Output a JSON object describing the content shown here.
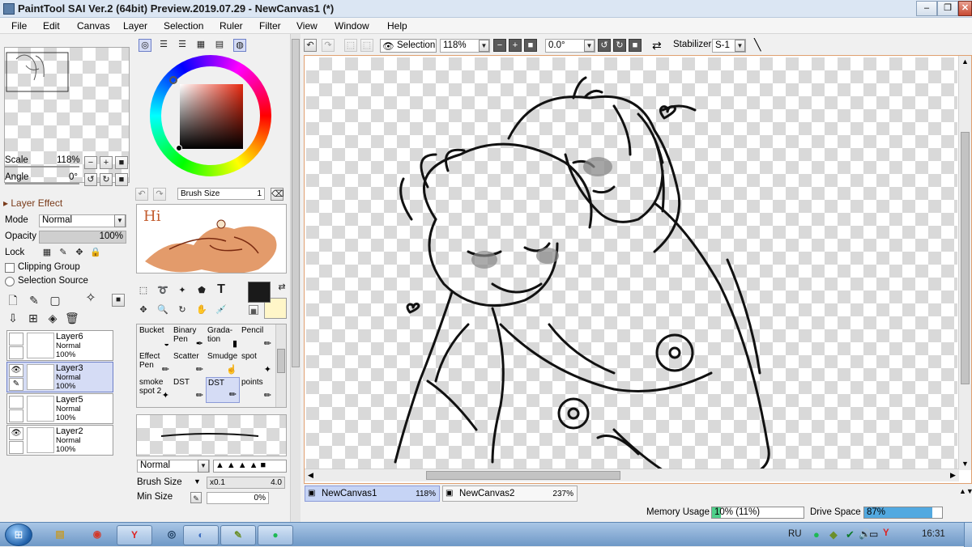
{
  "window": {
    "title": "PaintTool SAI Ver.2 (64bit) Preview.2019.07.29 - NewCanvas1 (*)",
    "minimize": "–",
    "restore": "❐",
    "close": "✕"
  },
  "menu": [
    "File",
    "Edit",
    "Canvas",
    "Layer",
    "Selection",
    "Ruler",
    "Filter",
    "View",
    "Window",
    "Help"
  ],
  "navigator": {
    "scale_label": "Scale",
    "scale_value": "118%",
    "angle_label": "Angle",
    "angle_value": "0°"
  },
  "layer_panel": {
    "effect_header": "Layer Effect",
    "mode_label": "Mode",
    "mode_value": "Normal",
    "opacity_label": "Opacity",
    "opacity_value": "100%",
    "opacity_fraction": 1.0,
    "lock_label": "Lock",
    "clipping_group": "Clipping Group",
    "selection_source": "Selection Source",
    "layers": [
      {
        "name": "Layer6",
        "mode": "Normal",
        "opacity": "100%",
        "visible": false,
        "selected": false
      },
      {
        "name": "Layer3",
        "mode": "Normal",
        "opacity": "100%",
        "visible": true,
        "selected": true
      },
      {
        "name": "Layer5",
        "mode": "Normal",
        "opacity": "100%",
        "visible": false,
        "selected": false
      },
      {
        "name": "Layer2",
        "mode": "Normal",
        "opacity": "100%",
        "visible": true,
        "selected": false
      }
    ]
  },
  "color_panel": {
    "brush_size_label": "Brush Size",
    "brush_size_value": "1",
    "scratch_text": "Hi",
    "primary_color": "#1a1a1a",
    "secondary_color": "#fff6c8"
  },
  "tools": [
    {
      "name": "Bucket",
      "icon": "🪣"
    },
    {
      "name": "Binary Pen",
      "icon": "✒"
    },
    {
      "name": "Grada-tion",
      "icon": "▮"
    },
    {
      "name": "Pencil",
      "icon": "✏"
    },
    {
      "name": "Effect Pen",
      "icon": "✏"
    },
    {
      "name": "Scatter",
      "icon": "✏"
    },
    {
      "name": "Smudge",
      "icon": "☝"
    },
    {
      "name": "spot",
      "icon": "✦"
    },
    {
      "name": "smoke spot 2",
      "icon": "✦"
    },
    {
      "name": "DST",
      "icon": "✏"
    },
    {
      "name": "DST",
      "icon": "✏",
      "selected": true
    },
    {
      "name": "points",
      "icon": "✏"
    }
  ],
  "brush_settings": {
    "blend_mode": "Normal",
    "brush_size_label": "Brush Size",
    "brush_multiplier": "x0.1",
    "brush_size_value": "4.0",
    "min_size_label": "Min Size",
    "min_size_value": "0%"
  },
  "canvas_toolbar": {
    "selection_label": "Selection",
    "zoom_value": "118%",
    "angle_value": "0.0°",
    "stabilizer_label": "Stabilizer",
    "stabilizer_value": "S-1"
  },
  "canvas_tabs": [
    {
      "name": "NewCanvas1",
      "zoom": "118%",
      "active": true
    },
    {
      "name": "NewCanvas2",
      "zoom": "237%",
      "active": false
    }
  ],
  "status": {
    "memory_label": "Memory Usage",
    "memory_value": "10% (11%)",
    "memory_fraction": 0.1,
    "drive_label": "Drive Space",
    "drive_value": "87%",
    "drive_fraction": 0.87
  },
  "taskbar": {
    "lang": "RU",
    "clock": "16:31",
    "apps": [
      "explorer-icon",
      "chrome-icon",
      "yandex-icon",
      "steam-icon",
      "paint-icon",
      "sai-icon",
      "spotify-icon"
    ]
  },
  "colors": {
    "accent_tab": "#c6d4f5",
    "memory_fill": "#4fd08a",
    "drive_fill": "#52a9e0"
  }
}
